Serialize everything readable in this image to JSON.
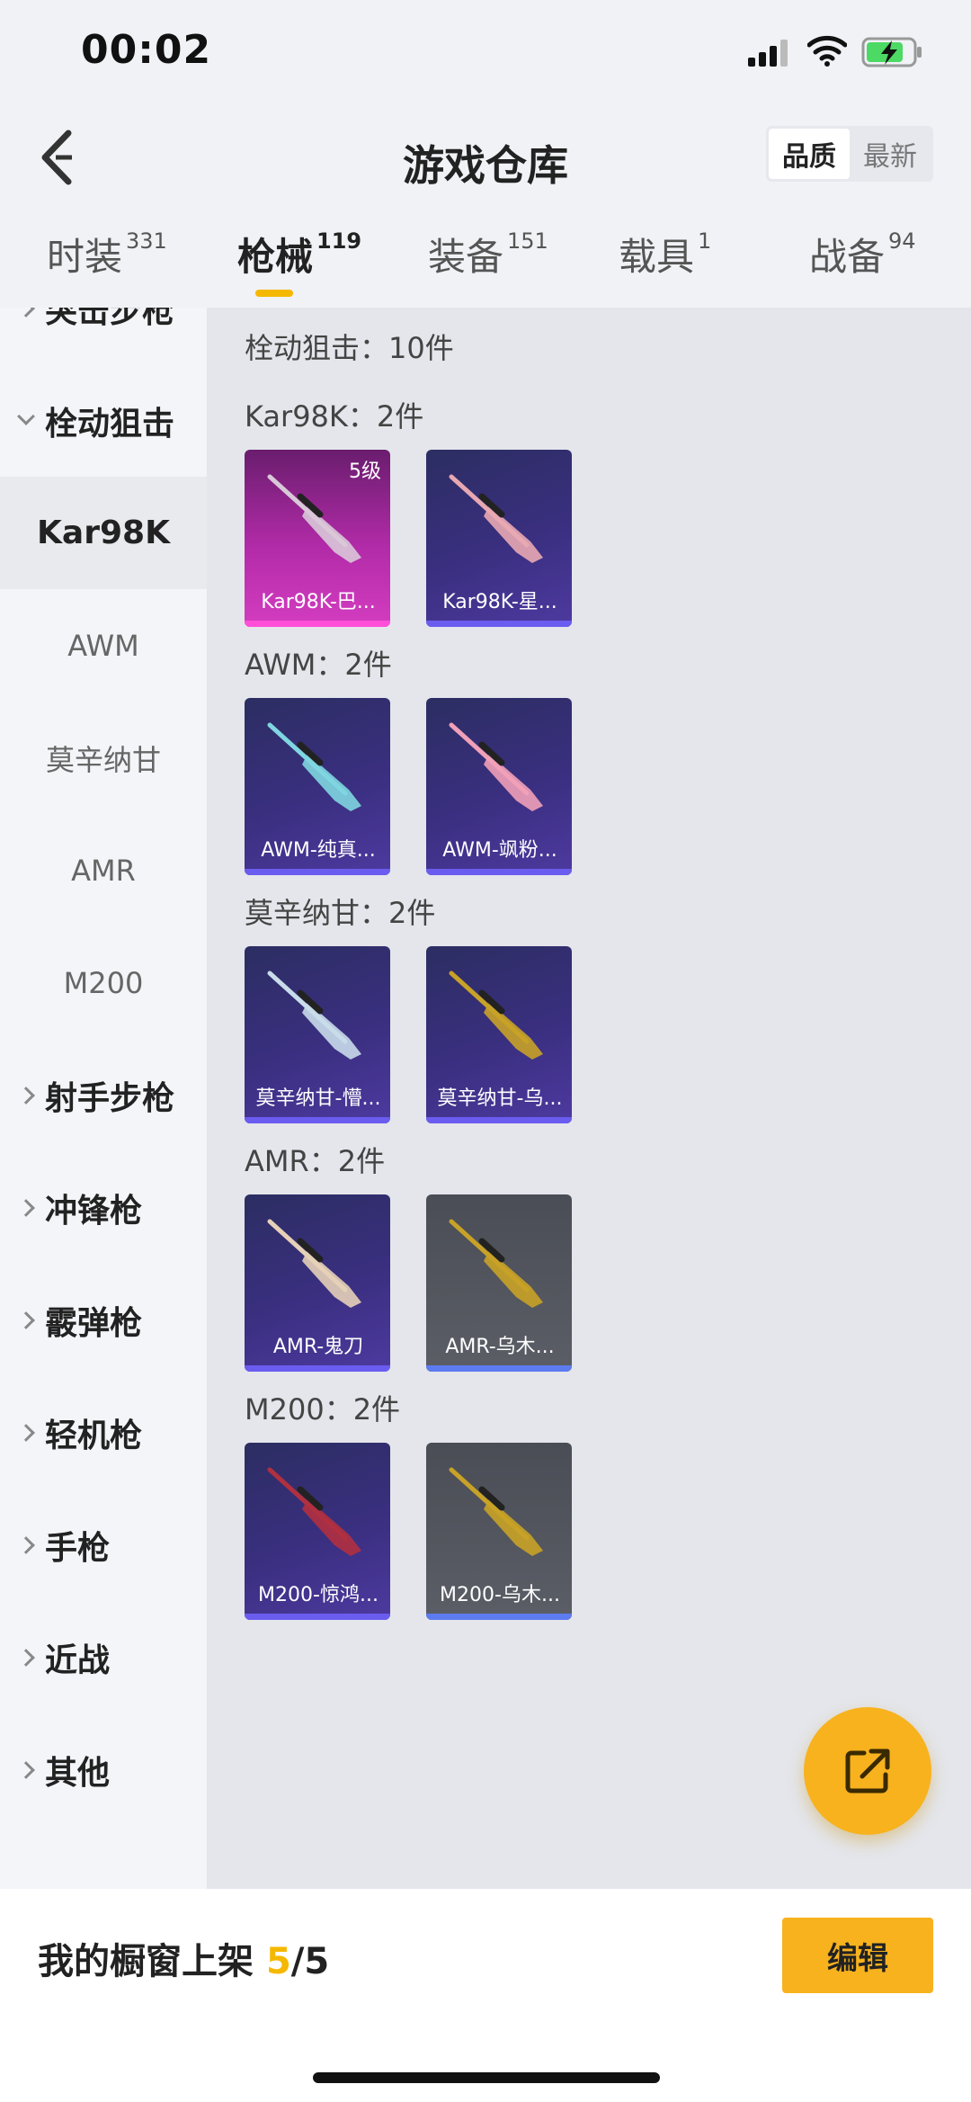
{
  "status_bar": {
    "time": "00:02"
  },
  "header": {
    "title": "游戏仓库",
    "sort_options": [
      "品质",
      "最新"
    ],
    "sort_active": "品质"
  },
  "tabs": [
    {
      "label": "时装",
      "count": "331"
    },
    {
      "label": "枪械",
      "count": "119",
      "active": true
    },
    {
      "label": "装备",
      "count": "151"
    },
    {
      "label": "载具",
      "count": "1"
    },
    {
      "label": "战备",
      "count": "94"
    }
  ],
  "sidebar": {
    "categories": [
      "突击步枪",
      "栓动狙击",
      "射手步枪",
      "冲锋枪",
      "霰弹枪",
      "轻机枪",
      "手枪",
      "近战",
      "其他"
    ],
    "expanded": "栓动狙击",
    "subitems": [
      "Kar98K",
      "AWM",
      "莫辛纳甘",
      "AMR",
      "M200"
    ],
    "active_sub": "Kar98K"
  },
  "content": {
    "summary": "栓动狙击：10件",
    "groups": [
      {
        "title": "Kar98K：2件",
        "items": [
          {
            "name": "Kar98K-巴...",
            "level": "5级",
            "style": "pink",
            "gun_color": "#d9c8d8"
          },
          {
            "name": "Kar98K-星...",
            "style": "purple",
            "gun_color": "#e8a8b2"
          }
        ]
      },
      {
        "title": "AWM：2件",
        "items": [
          {
            "name": "AWM-纯真...",
            "style": "purple",
            "gun_color": "#7fd6e0"
          },
          {
            "name": "AWM-飒粉...",
            "style": "purple",
            "gun_color": "#f0a0b8"
          }
        ]
      },
      {
        "title": "莫辛纳甘：2件",
        "items": [
          {
            "name": "莫辛纳甘-懵...",
            "style": "purple",
            "gun_color": "#c9dcea"
          },
          {
            "name": "莫辛纳甘-乌...",
            "style": "purple",
            "gun_color": "#c8a227"
          }
        ]
      },
      {
        "title": "AMR：2件",
        "items": [
          {
            "name": "AMR-鬼刀",
            "style": "purple",
            "gun_color": "#e6d0b8"
          },
          {
            "name": "AMR-乌木...",
            "style": "grey",
            "gun_color": "#c8a227"
          }
        ]
      },
      {
        "title": "M200：2件",
        "items": [
          {
            "name": "M200-惊鸿...",
            "style": "purple",
            "gun_color": "#b03040"
          },
          {
            "name": "M200-乌木...",
            "style": "grey",
            "gun_color": "#c8a227"
          }
        ]
      }
    ]
  },
  "fab": {
    "icon": "share-external-icon"
  },
  "bottom": {
    "shelf_label": "我的橱窗上架",
    "shelf_used": "5",
    "shelf_sep": "/",
    "shelf_total": "5",
    "edit_label": "编辑"
  },
  "colors": {
    "accent": "#f7b21e",
    "tab_underline": "#f5b800"
  }
}
